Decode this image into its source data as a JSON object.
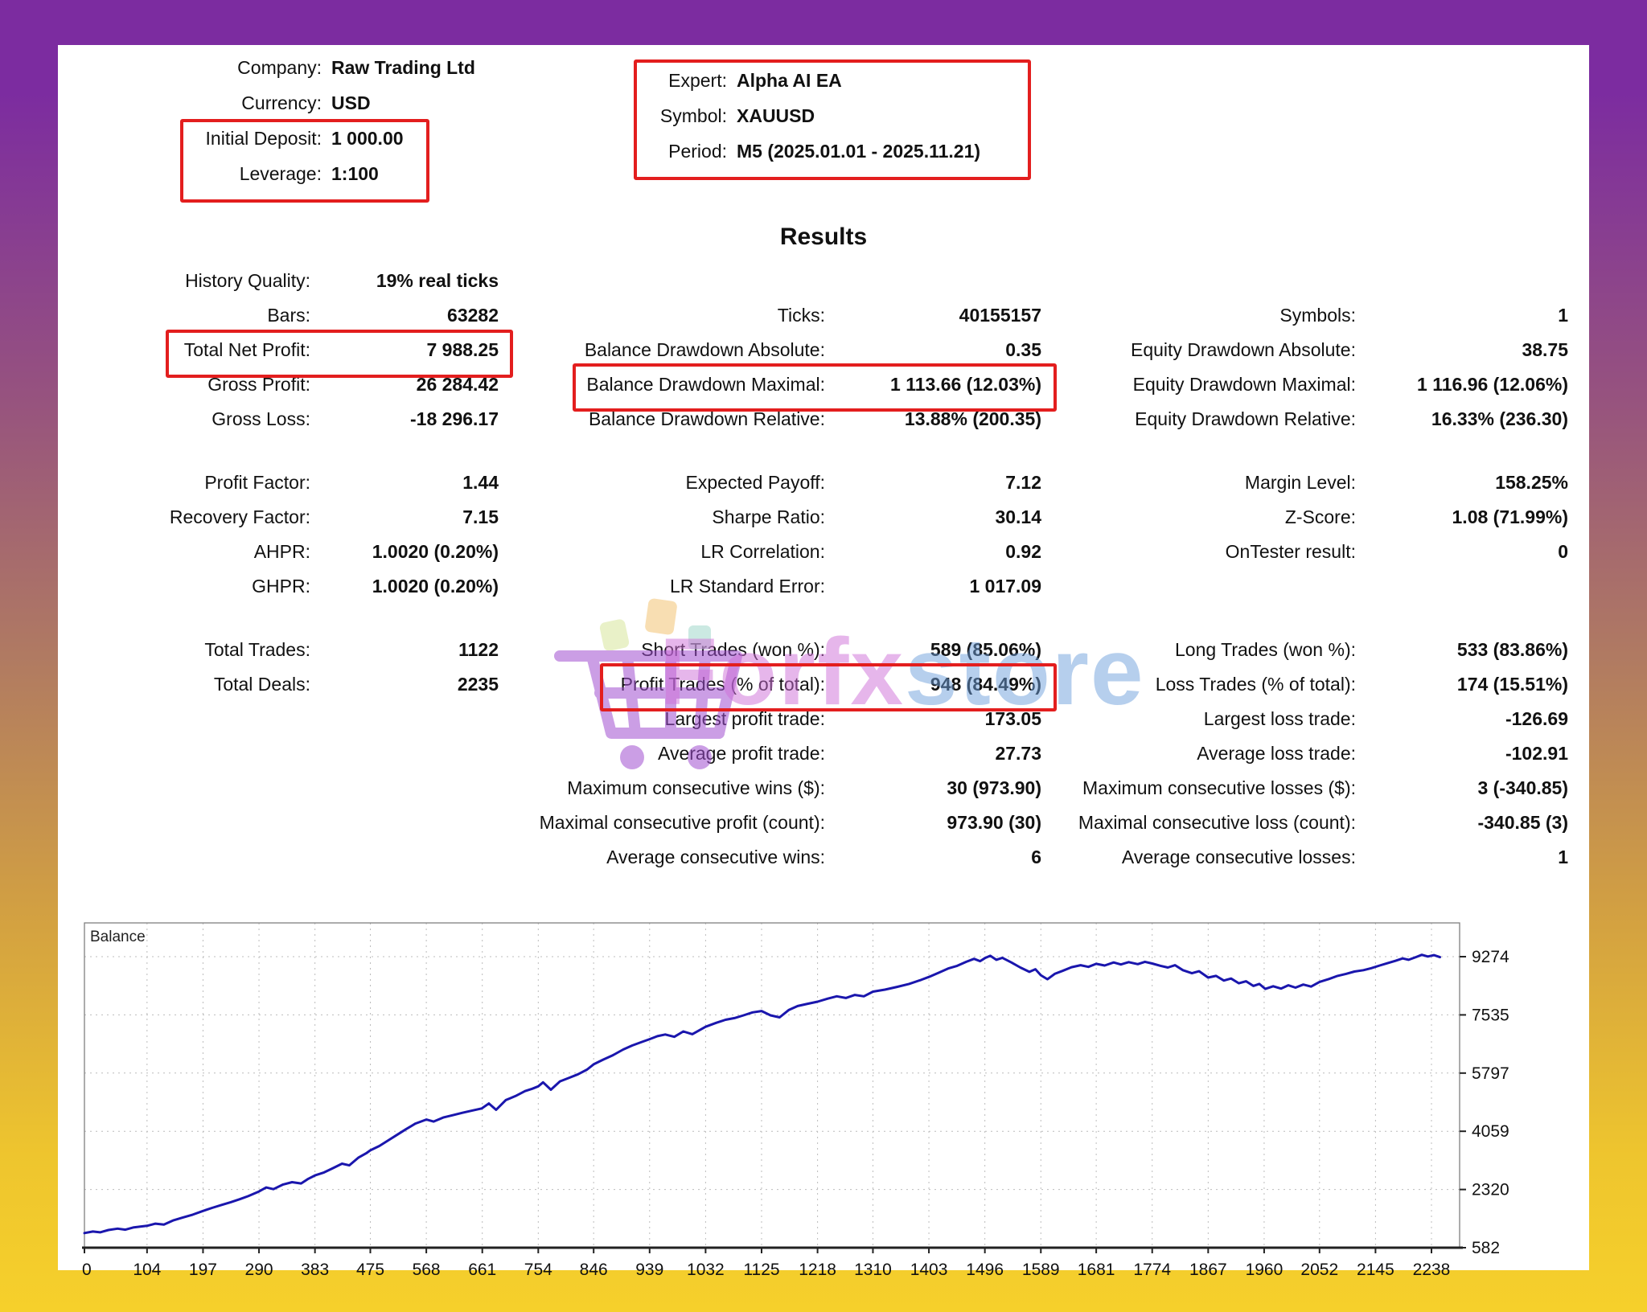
{
  "header": {
    "left": {
      "rows": [
        {
          "label": "Company:",
          "value": "Raw Trading Ltd"
        },
        {
          "label": "Currency:",
          "value": "USD"
        },
        {
          "label": "Initial Deposit:",
          "value": "1 000.00"
        },
        {
          "label": "Leverage:",
          "value": "1:100"
        }
      ]
    },
    "right": {
      "rows": [
        {
          "label": "Expert:",
          "value": "Alpha AI EA"
        },
        {
          "label": "Symbol:",
          "value": "XAUUSD"
        },
        {
          "label": "Period:",
          "value": "M5 (2025.01.01 - 2025.11.21)"
        }
      ]
    }
  },
  "results_title": "Results",
  "stats": {
    "col1": {
      "rows": [
        {
          "label": "History Quality:",
          "value": "19% real ticks"
        },
        {
          "label": "Bars:",
          "value": "63282"
        },
        {
          "label": "Total Net Profit:",
          "value": "7 988.25"
        },
        {
          "label": "Gross Profit:",
          "value": "26 284.42"
        },
        {
          "label": "Gross Loss:",
          "value": "-18 296.17"
        },
        {
          "spacer": true
        },
        {
          "label": "Profit Factor:",
          "value": "1.44"
        },
        {
          "label": "Recovery Factor:",
          "value": "7.15"
        },
        {
          "label": "AHPR:",
          "value": "1.0020 (0.20%)"
        },
        {
          "label": "GHPR:",
          "value": "1.0020 (0.20%)"
        },
        {
          "spacer": true
        },
        {
          "label": "Total Trades:",
          "value": "1122"
        },
        {
          "label": "Total Deals:",
          "value": "2235"
        }
      ]
    },
    "col2": {
      "rows": [
        {
          "label": "",
          "value": ""
        },
        {
          "label": "Ticks:",
          "value": "40155157"
        },
        {
          "label": "Balance Drawdown Absolute:",
          "value": "0.35"
        },
        {
          "label": "Balance Drawdown Maximal:",
          "value": "1 113.66 (12.03%)"
        },
        {
          "label": "Balance Drawdown Relative:",
          "value": "13.88% (200.35)"
        },
        {
          "spacer": true
        },
        {
          "label": "Expected Payoff:",
          "value": "7.12"
        },
        {
          "label": "Sharpe Ratio:",
          "value": "30.14"
        },
        {
          "label": "LR Correlation:",
          "value": "0.92"
        },
        {
          "label": "LR Standard Error:",
          "value": "1 017.09"
        },
        {
          "spacer": true
        },
        {
          "label": "Short Trades (won %):",
          "value": "589 (85.06%)"
        },
        {
          "label": "Profit Trades (% of total):",
          "value": "948 (84.49%)"
        },
        {
          "label": "Largest profit trade:",
          "value": "173.05"
        },
        {
          "label": "Average profit trade:",
          "value": "27.73"
        },
        {
          "label": "Maximum consecutive wins ($):",
          "value": "30 (973.90)"
        },
        {
          "label": "Maximal consecutive profit (count):",
          "value": "973.90 (30)"
        },
        {
          "label": "Average consecutive wins:",
          "value": "6"
        }
      ]
    },
    "col3": {
      "rows": [
        {
          "label": "",
          "value": ""
        },
        {
          "label": "Symbols:",
          "value": "1"
        },
        {
          "label": "Equity Drawdown Absolute:",
          "value": "38.75"
        },
        {
          "label": "Equity Drawdown Maximal:",
          "value": "1 116.96 (12.06%)"
        },
        {
          "label": "Equity Drawdown Relative:",
          "value": "16.33% (236.30)"
        },
        {
          "spacer": true
        },
        {
          "label": "Margin Level:",
          "value": "158.25%"
        },
        {
          "label": "Z-Score:",
          "value": "1.08 (71.99%)"
        },
        {
          "label": "OnTester result:",
          "value": "0"
        },
        {
          "label": "",
          "value": ""
        },
        {
          "spacer": true
        },
        {
          "label": "Long Trades (won %):",
          "value": "533 (83.86%)"
        },
        {
          "label": "Loss Trades (% of total):",
          "value": "174 (15.51%)"
        },
        {
          "label": "Largest loss trade:",
          "value": "-126.69"
        },
        {
          "label": "Average loss trade:",
          "value": "-102.91"
        },
        {
          "label": "Maximum consecutive losses ($):",
          "value": "3 (-340.85)"
        },
        {
          "label": "Maximal consecutive loss (count):",
          "value": "-340.85 (3)"
        },
        {
          "label": "Average consecutive losses:",
          "value": "1"
        }
      ]
    }
  },
  "watermark": {
    "icon": "shopping-cart-icon",
    "brand_part1": "Forfx",
    "brand_part2": "store",
    "color1": "#cf6fd8",
    "color2": "#6fa0dc"
  },
  "highlight_color": "#e31e1e",
  "chart_data": {
    "type": "line",
    "title": "Balance",
    "xlabel": "",
    "ylabel": "",
    "grid": true,
    "x_ticks": [
      0,
      104,
      197,
      290,
      383,
      475,
      568,
      661,
      754,
      846,
      939,
      1032,
      1125,
      1218,
      1310,
      1403,
      1496,
      1589,
      1681,
      1774,
      1867,
      1960,
      2052,
      2145,
      2238
    ],
    "y_ticks": [
      582,
      2320,
      4059,
      5797,
      7535,
      9274
    ],
    "xlim": [
      0,
      2284
    ],
    "ylim": [
      582,
      10280
    ],
    "series": [
      {
        "name": "Balance",
        "color": "#1a16ad",
        "points": [
          [
            0,
            1020
          ],
          [
            14,
            1065
          ],
          [
            26,
            1040
          ],
          [
            40,
            1110
          ],
          [
            55,
            1150
          ],
          [
            68,
            1120
          ],
          [
            82,
            1190
          ],
          [
            104,
            1235
          ],
          [
            118,
            1300
          ],
          [
            132,
            1270
          ],
          [
            148,
            1400
          ],
          [
            163,
            1480
          ],
          [
            180,
            1570
          ],
          [
            197,
            1680
          ],
          [
            212,
            1770
          ],
          [
            228,
            1860
          ],
          [
            243,
            1940
          ],
          [
            258,
            2030
          ],
          [
            272,
            2120
          ],
          [
            290,
            2260
          ],
          [
            302,
            2380
          ],
          [
            314,
            2330
          ],
          [
            330,
            2470
          ],
          [
            345,
            2540
          ],
          [
            360,
            2500
          ],
          [
            372,
            2640
          ],
          [
            383,
            2740
          ],
          [
            398,
            2830
          ],
          [
            412,
            2950
          ],
          [
            428,
            3090
          ],
          [
            440,
            3040
          ],
          [
            455,
            3270
          ],
          [
            468,
            3400
          ],
          [
            475,
            3490
          ],
          [
            490,
            3620
          ],
          [
            505,
            3790
          ],
          [
            520,
            3960
          ],
          [
            534,
            4120
          ],
          [
            550,
            4290
          ],
          [
            568,
            4410
          ],
          [
            580,
            4350
          ],
          [
            596,
            4470
          ],
          [
            612,
            4540
          ],
          [
            628,
            4610
          ],
          [
            645,
            4680
          ],
          [
            660,
            4740
          ],
          [
            672,
            4890
          ],
          [
            684,
            4700
          ],
          [
            700,
            4990
          ],
          [
            716,
            5110
          ],
          [
            732,
            5260
          ],
          [
            744,
            5330
          ],
          [
            754,
            5400
          ],
          [
            762,
            5520
          ],
          [
            775,
            5300
          ],
          [
            790,
            5550
          ],
          [
            806,
            5660
          ],
          [
            820,
            5760
          ],
          [
            835,
            5900
          ],
          [
            846,
            6060
          ],
          [
            862,
            6200
          ],
          [
            878,
            6330
          ],
          [
            895,
            6500
          ],
          [
            910,
            6620
          ],
          [
            925,
            6720
          ],
          [
            939,
            6810
          ],
          [
            952,
            6900
          ],
          [
            965,
            6950
          ],
          [
            980,
            6880
          ],
          [
            995,
            7040
          ],
          [
            1010,
            6960
          ],
          [
            1032,
            7180
          ],
          [
            1050,
            7300
          ],
          [
            1065,
            7390
          ],
          [
            1080,
            7440
          ],
          [
            1095,
            7520
          ],
          [
            1110,
            7610
          ],
          [
            1125,
            7650
          ],
          [
            1140,
            7520
          ],
          [
            1155,
            7460
          ],
          [
            1170,
            7680
          ],
          [
            1185,
            7800
          ],
          [
            1200,
            7860
          ],
          [
            1218,
            7930
          ],
          [
            1235,
            8020
          ],
          [
            1250,
            8090
          ],
          [
            1265,
            8040
          ],
          [
            1280,
            8130
          ],
          [
            1295,
            8090
          ],
          [
            1310,
            8230
          ],
          [
            1330,
            8290
          ],
          [
            1350,
            8370
          ],
          [
            1370,
            8460
          ],
          [
            1390,
            8580
          ],
          [
            1403,
            8670
          ],
          [
            1420,
            8800
          ],
          [
            1435,
            8920
          ],
          [
            1450,
            9000
          ],
          [
            1465,
            9120
          ],
          [
            1478,
            9210
          ],
          [
            1488,
            9140
          ],
          [
            1496,
            9230
          ],
          [
            1505,
            9300
          ],
          [
            1515,
            9180
          ],
          [
            1525,
            9240
          ],
          [
            1540,
            9100
          ],
          [
            1555,
            8950
          ],
          [
            1570,
            8820
          ],
          [
            1580,
            8900
          ],
          [
            1589,
            8720
          ],
          [
            1600,
            8600
          ],
          [
            1612,
            8760
          ],
          [
            1625,
            8850
          ],
          [
            1640,
            8960
          ],
          [
            1655,
            9020
          ],
          [
            1668,
            8970
          ],
          [
            1681,
            9060
          ],
          [
            1695,
            9010
          ],
          [
            1710,
            9100
          ],
          [
            1722,
            9040
          ],
          [
            1735,
            9110
          ],
          [
            1750,
            9050
          ],
          [
            1762,
            9120
          ],
          [
            1774,
            9070
          ],
          [
            1788,
            9000
          ],
          [
            1800,
            8950
          ],
          [
            1812,
            9020
          ],
          [
            1825,
            8870
          ],
          [
            1840,
            8780
          ],
          [
            1852,
            8840
          ],
          [
            1867,
            8650
          ],
          [
            1880,
            8700
          ],
          [
            1893,
            8560
          ],
          [
            1905,
            8620
          ],
          [
            1918,
            8480
          ],
          [
            1930,
            8540
          ],
          [
            1942,
            8400
          ],
          [
            1952,
            8460
          ],
          [
            1962,
            8310
          ],
          [
            1975,
            8390
          ],
          [
            1988,
            8320
          ],
          [
            2000,
            8420
          ],
          [
            2012,
            8350
          ],
          [
            2025,
            8440
          ],
          [
            2038,
            8380
          ],
          [
            2052,
            8520
          ],
          [
            2068,
            8610
          ],
          [
            2082,
            8700
          ],
          [
            2096,
            8760
          ],
          [
            2110,
            8830
          ],
          [
            2125,
            8870
          ],
          [
            2138,
            8930
          ],
          [
            2152,
            9010
          ],
          [
            2165,
            9080
          ],
          [
            2178,
            9150
          ],
          [
            2190,
            9220
          ],
          [
            2200,
            9180
          ],
          [
            2212,
            9260
          ],
          [
            2222,
            9330
          ],
          [
            2232,
            9280
          ],
          [
            2242,
            9320
          ],
          [
            2252,
            9260
          ]
        ]
      }
    ]
  }
}
